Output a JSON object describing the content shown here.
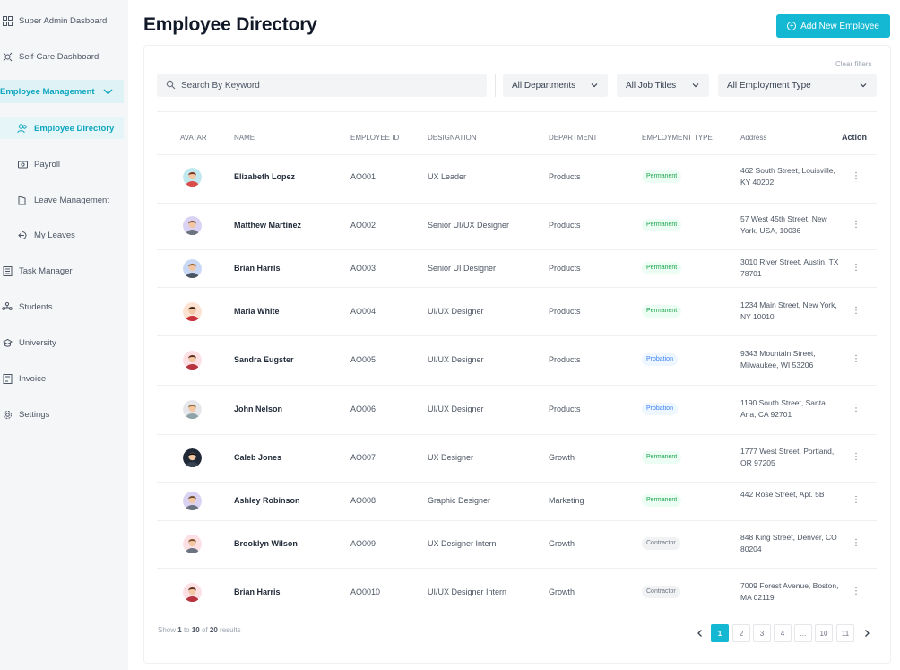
{
  "sidebar": {
    "items": [
      {
        "label": "Super Admin Dasboard",
        "icon": "dashboard-grid-icon"
      },
      {
        "label": "Self-Care Dashboard",
        "icon": "self-care-icon"
      },
      {
        "label": "Employee Management",
        "icon": "chevron-down-icon"
      },
      {
        "label": "Employee Directory",
        "icon": "users-icon"
      },
      {
        "label": "Payroll",
        "icon": "payroll-icon"
      },
      {
        "label": "Leave Management",
        "icon": "leave-icon"
      },
      {
        "label": "My Leaves",
        "icon": "logout-arrow-icon"
      },
      {
        "label": "Task Manager",
        "icon": "task-icon"
      },
      {
        "label": "Students",
        "icon": "students-icon"
      },
      {
        "label": "University",
        "icon": "university-icon"
      },
      {
        "label": "Invoice",
        "icon": "invoice-icon"
      },
      {
        "label": "Settings",
        "icon": "gear-icon"
      }
    ]
  },
  "header": {
    "title": "Employee Directory",
    "add_button_label": "Add New Employee"
  },
  "filters": {
    "clear_label": "Clear filters",
    "search_placeholder": "Search By Keyword",
    "departments": "All Departments",
    "job_titles": "All Job Titles",
    "employment_type": "All Employment Type"
  },
  "table": {
    "columns": [
      "AVATAR",
      "NAME",
      "EMPLOYEE ID",
      "DESIGNATION",
      "DEPARTMENT",
      "EMPLOYMENT TYPE",
      "Address",
      "Action"
    ],
    "rows": [
      {
        "name": "Elizabeth Lopez",
        "id": "AO001",
        "designation": "UX Leader",
        "department": "Products",
        "type": "Permanent",
        "address": "462 South Street, Louisville, KY 40202"
      },
      {
        "name": "Matthew Martinez",
        "id": "AO002",
        "designation": "Senior UI/UX Designer",
        "department": "Products",
        "type": "Permanent",
        "address": "57 West 45th Street, New York, USA, 10036"
      },
      {
        "name": "Brian Harris",
        "id": "AO003",
        "designation": "Senior UI Designer",
        "department": "Products",
        "type": "Permanent",
        "address": "3010 River Street, Austin, TX 78701"
      },
      {
        "name": "Maria White",
        "id": "AO004",
        "designation": "UI/UX Designer",
        "department": "Products",
        "type": "Permanent",
        "address": "1234 Main Street, New York, NY 10010"
      },
      {
        "name": "Sandra Eugster",
        "id": "AO005",
        "designation": "UI/UX Designer",
        "department": "Products",
        "type": "Probation",
        "address": "9343 Mountain Street, Milwaukee, WI 53206"
      },
      {
        "name": "John Nelson",
        "id": "AO006",
        "designation": "UI/UX Designer",
        "department": "Products",
        "type": "Probation",
        "address": "1190 South Street, Santa Ana, CA 92701"
      },
      {
        "name": "Caleb Jones",
        "id": "AO007",
        "designation": "UX Designer",
        "department": "Growth",
        "type": "Permanent",
        "address": "1777 West Street, Portland, OR 97205"
      },
      {
        "name": "Ashley Robinson",
        "id": "AO008",
        "designation": "Graphic Designer",
        "department": "Marketing",
        "type": "Permanent",
        "address": "442 Rose Street, Apt. 5B"
      },
      {
        "name": "Brooklyn Wilson",
        "id": "AO009",
        "designation": "UX Designer Intern",
        "department": "Growth",
        "type": "Contractor",
        "address": "848 King Street, Denver, CO 80204"
      },
      {
        "name": "Brian Harris",
        "id": "AO0010",
        "designation": "UI/UX Designer Intern",
        "department": "Growth",
        "type": "Contractor",
        "address": "7009 Forest Avenue, Boston, MA 02119"
      }
    ]
  },
  "footer": {
    "results_prefix": "Show",
    "results_from": "1",
    "results_to_word": "to",
    "results_to": "10",
    "results_of_word": "of",
    "results_total": "20",
    "results_suffix": "results",
    "pages": [
      "1",
      "2",
      "3",
      "4",
      "...",
      "10",
      "11"
    ]
  },
  "colors": {
    "accent": "#14b8d2",
    "permanent": "#16a34a",
    "probation": "#3b82f6",
    "contractor": "#6b7280"
  }
}
